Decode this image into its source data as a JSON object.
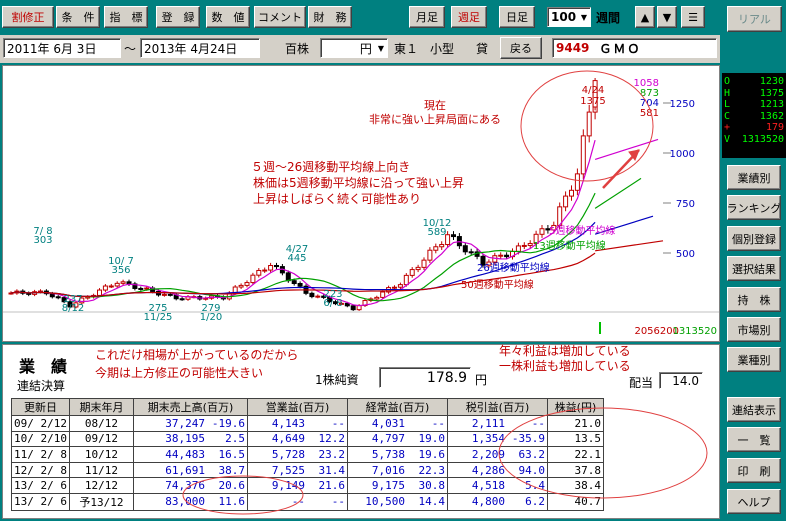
{
  "toolbar": {
    "buttons": [
      "修正",
      "条　件",
      "指　標",
      "登　録",
      "数　値",
      "コメント",
      "財　務"
    ],
    "first_prefix": "割",
    "monthly": "月足",
    "weekly": "週足",
    "daily": "日足",
    "count_value": "100",
    "period_label": "週間",
    "up": "▲",
    "down": "▼",
    "menu": "☰",
    "real": "リアル"
  },
  "filter": {
    "date_from": "2011年 6月 3日",
    "tilde": "～",
    "date_to": "2013年 4月24日",
    "unit": "百株",
    "currency": "円",
    "market": "東１",
    "size": "小型",
    "margin": "貸",
    "back": "戻る",
    "code": "9449",
    "name": "ＧＭＯ"
  },
  "quote": {
    "rows": [
      {
        "k": "O",
        "v": "1230",
        "c": "#00ff00"
      },
      {
        "k": "H",
        "v": "1375",
        "c": "#00ff00"
      },
      {
        "k": "L",
        "v": "1213",
        "c": "#00ff00"
      },
      {
        "k": "C",
        "v": "1362",
        "c": "#00ff00"
      },
      {
        "k": "+",
        "v": "179",
        "c": "#ff2020"
      },
      {
        "k": "V",
        "v": "1313520",
        "c": "#00ff00"
      }
    ]
  },
  "side_menu": [
    "業績別",
    "ランキング",
    "個別登録",
    "選択結果",
    "持　株",
    "市場別",
    "業種別",
    "連結表示",
    "一　覧",
    "印　刷",
    "ヘルプ"
  ],
  "chart": {
    "y_ticks": [
      "1250",
      "1000",
      "750",
      "500"
    ],
    "right_labels": [
      "1058",
      "873",
      "704",
      "581"
    ],
    "right_label_colors": [
      "#d000d0",
      "#00a000",
      "#0000c0",
      "#c00000"
    ],
    "peak_label": [
      "4/24",
      "1375"
    ],
    "annotations": [
      {
        "date": "7/ 8",
        "price": "303"
      },
      {
        "date": "10/ 7",
        "price": "356"
      },
      {
        "date": "4/27",
        "price": "445"
      },
      {
        "date": "10/12",
        "price": "589"
      },
      {
        "date": "8/12",
        "price": "237"
      },
      {
        "date": "11/25",
        "price": "275"
      },
      {
        "date": "1/20",
        "price": "279"
      },
      {
        "date": "6/ 8",
        "price": "223"
      }
    ],
    "ma_labels": [
      {
        "text": "5週移動平均線",
        "color": "#d000d0"
      },
      {
        "text": "13週移動平均線",
        "color": "#00a000"
      },
      {
        "text": "26週移動平均線",
        "color": "#0000c0"
      },
      {
        "text": "50週移動平均線",
        "color": "#c00000"
      }
    ],
    "note_now": [
      "現在",
      "非常に強い上昇局面にある"
    ],
    "note_trend": [
      "５週～26週移動平均線上向き",
      "株価は5週移動平均線に沿って強い上昇",
      "上昇はしばらく続く可能性あり"
    ],
    "volume_left": "2056200",
    "volume_right": "1313520"
  },
  "chart_data": {
    "type": "candlestick",
    "period": "2011/6/3 - 2013/4/24 (weekly)",
    "y_ticks": [
      500,
      750,
      1000,
      1250
    ],
    "last": {
      "date": "4/24",
      "open": 1230,
      "high": 1375,
      "low": 1213,
      "close": 1362
    },
    "moving_averages": [
      {
        "name": "5週",
        "value": 1058
      },
      {
        "name": "13週",
        "value": 873
      },
      {
        "name": "26週",
        "value": 704
      },
      {
        "name": "50週",
        "value": 581
      }
    ],
    "marked_highs": [
      {
        "date": "7/8",
        "v": 303
      },
      {
        "date": "10/7",
        "v": 356
      },
      {
        "date": "4/27",
        "v": 445
      },
      {
        "date": "10/12",
        "v": 589
      },
      {
        "date": "4/24",
        "v": 1375
      }
    ],
    "marked_lows": [
      {
        "date": "8/12",
        "v": 237
      },
      {
        "date": "11/25",
        "v": 275
      },
      {
        "date": "1/20",
        "v": 279
      },
      {
        "date": "6/8",
        "v": 223
      }
    ]
  },
  "perf": {
    "title": "業　績",
    "subtitle": "連結決算",
    "per_share_label": "1株純資",
    "per_share_value": "178.9",
    "per_share_unit": "円",
    "dividend_label": "配当",
    "dividend_value": "14.0",
    "note1": [
      "これだけ相場が上がっているのだから",
      "今期は上方修正の可能性大きい"
    ],
    "note2": [
      "年々利益は増加している",
      "一株利益も増加している"
    ],
    "headers": [
      "更新日",
      "期末年月",
      "期末売上高(百万)",
      "営業益(百万)",
      "経常益(百万)",
      "税引益(百万)",
      "株益(円)"
    ],
    "rows": [
      [
        "09/ 2/12",
        "08/12",
        "37,247",
        "-19.6",
        "4,143",
        "--",
        "4,031",
        "--",
        "2,111",
        "--",
        "21.0"
      ],
      [
        "10/ 2/10",
        "09/12",
        "38,195",
        "2.5",
        "4,649",
        "12.2",
        "4,797",
        "19.0",
        "1,354",
        "-35.9",
        "13.5"
      ],
      [
        "11/ 2/ 8",
        "10/12",
        "44,483",
        "16.5",
        "5,728",
        "23.2",
        "5,738",
        "19.6",
        "2,209",
        "63.2",
        "22.1"
      ],
      [
        "12/ 2/ 8",
        "11/12",
        "61,691",
        "38.7",
        "7,525",
        "31.4",
        "7,016",
        "22.3",
        "4,286",
        "94.0",
        "37.8"
      ],
      [
        "13/ 2/ 6",
        "12/12",
        "74,376",
        "20.6",
        "9,149",
        "21.6",
        "9,175",
        "30.8",
        "4,518",
        "5.4",
        "38.4"
      ],
      [
        "13/ 2/ 6",
        "予13/12",
        "83,000",
        "11.6",
        "--",
        "--",
        "10,500",
        "14.4",
        "4,800",
        "6.2",
        "40.7"
      ]
    ]
  }
}
